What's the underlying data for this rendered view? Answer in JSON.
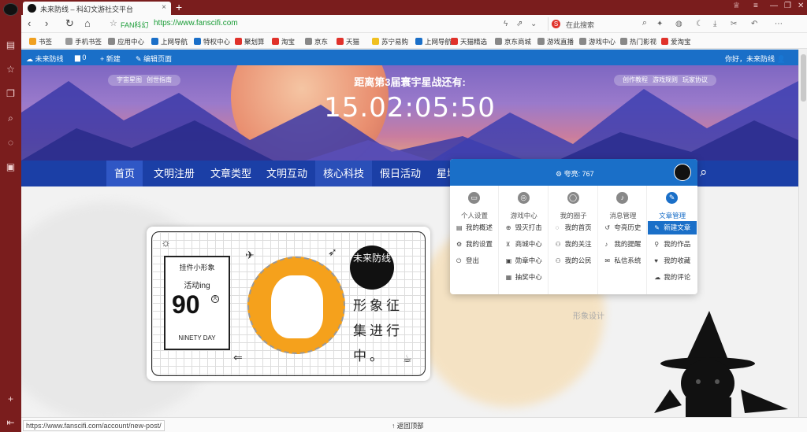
{
  "browser": {
    "tab_title": "未来防线 – 科幻文游社交平台",
    "new_tab_symbol": "+",
    "url_site_label": "FAN科幻",
    "url": "https://www.fanscifi.com",
    "search_placeholder": "在此搜索",
    "status_url": "https://www.fanscifi.com/account/new-post/"
  },
  "bookmarks": [
    {
      "label": "书签",
      "color": "#f0a020"
    },
    {
      "label": "手机书签",
      "color": "#999999"
    },
    {
      "label": "应用中心",
      "color": "#888888"
    },
    {
      "label": "上网导航",
      "color": "#1a6fc8"
    },
    {
      "label": "特权中心",
      "color": "#1a6fc8"
    },
    {
      "label": "聚划算",
      "color": "#e0322b"
    },
    {
      "label": "淘宝",
      "color": "#e0322b"
    },
    {
      "label": "京东",
      "color": "#888888"
    },
    {
      "label": "天猫",
      "color": "#e0322b"
    },
    {
      "label": "苏宁易购",
      "color": "#f0c020"
    },
    {
      "label": "上网导航",
      "color": "#1a6fc8"
    },
    {
      "label": "天猫精选",
      "color": "#e0322b"
    },
    {
      "label": "京东商城",
      "color": "#888888"
    },
    {
      "label": "游戏直播",
      "color": "#888888"
    },
    {
      "label": "游戏中心",
      "color": "#888888"
    },
    {
      "label": "热门影视",
      "color": "#888888"
    },
    {
      "label": "爱淘宝",
      "color": "#e0322b"
    }
  ],
  "adminbar": {
    "site_name": "未来防线",
    "comments_count": "0",
    "new_label": "新建",
    "edit_label": "编辑页面",
    "greeting": "你好，未来防线"
  },
  "banner": {
    "left_pills": [
      "宇宙星图",
      "创世指南"
    ],
    "right_pills": [
      "创作教程",
      "游戏规则",
      "玩家协议"
    ],
    "countdown_title": "距离第3届寰宇星战还有:",
    "countdown_time": "15.02:05:50"
  },
  "nav": {
    "items": [
      "首页",
      "文明注册",
      "文章类型",
      "文明互动",
      "核心科技",
      "假日活动",
      "星域"
    ]
  },
  "card": {
    "badge_top": "挂件小形象",
    "badge_status": "活动ing",
    "badge_number": "90",
    "badge_number_suffix": "天",
    "badge_bottom": "NINETY DAY",
    "logo_text": "未来防线",
    "vertical_line1": "形象征",
    "vertical_line2": "集进行",
    "vertical_line3": "中。"
  },
  "content": {
    "overlay_sub": "形象设计"
  },
  "dropdown": {
    "praise_label": "夸亮:",
    "praise_value": "767",
    "columns": [
      {
        "title": "个人设置",
        "icon": "id-card-icon",
        "items": [
          {
            "label": "我的概述",
            "icon": "overview-icon"
          },
          {
            "label": "我的设置",
            "icon": "cog-icon"
          },
          {
            "label": "登出",
            "icon": "power-icon"
          }
        ]
      },
      {
        "title": "游戏中心",
        "icon": "gamepad-icon",
        "items": [
          {
            "label": "毁灭打击",
            "icon": "crosshair-icon"
          },
          {
            "label": "商城中心",
            "icon": "cart-icon"
          },
          {
            "label": "勋章中心",
            "icon": "medal-icon"
          },
          {
            "label": "抽奖中心",
            "icon": "gift-icon"
          }
        ]
      },
      {
        "title": "我的圈子",
        "icon": "circle-icon",
        "items": [
          {
            "label": "我的首页",
            "icon": "home-circle-icon"
          },
          {
            "label": "我的关注",
            "icon": "users-icon"
          },
          {
            "label": "我的公民",
            "icon": "users-icon"
          }
        ]
      },
      {
        "title": "消息管理",
        "icon": "bell-icon",
        "items": [
          {
            "label": "夸亮历史",
            "icon": "history-icon"
          },
          {
            "label": "我的提醒",
            "icon": "bell-icon"
          },
          {
            "label": "私信系统",
            "icon": "mail-icon"
          }
        ]
      },
      {
        "title": "文章管理",
        "icon": "pencil-icon",
        "items": [
          {
            "label": "新建文章",
            "icon": "pencil-icon"
          },
          {
            "label": "我的作品",
            "icon": "pin-icon"
          },
          {
            "label": "我的收藏",
            "icon": "heart-icon"
          },
          {
            "label": "我的评论",
            "icon": "comments-icon"
          }
        ]
      }
    ]
  },
  "statusbar": {
    "back_to_top": "返回顶部"
  },
  "colors": {
    "brand_blue": "#1a6fc8",
    "nav_blue": "#1b3fa6",
    "browser_red": "#7a1d1d",
    "url_green": "#1a9c37"
  }
}
